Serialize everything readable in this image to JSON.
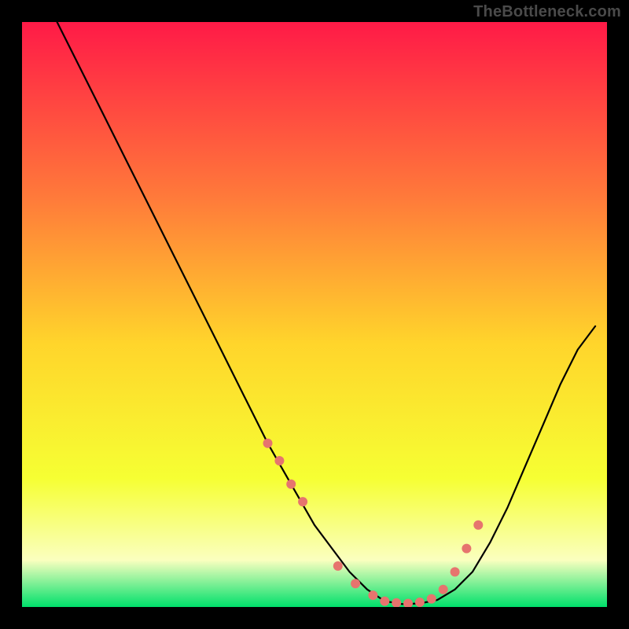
{
  "watermark": "TheBottleneck.com",
  "colors": {
    "gradient_top": "#ff1a47",
    "gradient_mid1": "#ff7a3a",
    "gradient_mid2": "#ffd52b",
    "gradient_mid3": "#f6ff33",
    "gradient_bottom_yellow": "#faffbf",
    "gradient_bottom_green": "#00e06b",
    "curve": "#000000",
    "marker": "#e6746e",
    "background": "#000000"
  },
  "chart_data": {
    "type": "line",
    "title": "",
    "xlabel": "",
    "ylabel": "",
    "xlim": [
      0,
      100
    ],
    "ylim": [
      0,
      100
    ],
    "curve": {
      "x": [
        6,
        10,
        14,
        18,
        22,
        26,
        30,
        34,
        38,
        42,
        46,
        50,
        53,
        56,
        59,
        62,
        65,
        68,
        71,
        74,
        77,
        80,
        83,
        86,
        89,
        92,
        95,
        98
      ],
      "y": [
        100,
        92,
        84,
        76,
        68,
        60,
        52,
        44,
        36,
        28,
        21,
        14,
        10,
        6,
        3,
        1,
        0.5,
        0.6,
        1.2,
        3,
        6,
        11,
        17,
        24,
        31,
        38,
        44,
        48
      ]
    },
    "markers": {
      "x": [
        42,
        44,
        46,
        48,
        54,
        57,
        60,
        62,
        64,
        66,
        68,
        70,
        72,
        74,
        76,
        78
      ],
      "y": [
        28,
        25,
        21,
        18,
        7,
        4,
        2,
        1,
        0.7,
        0.6,
        0.8,
        1.4,
        3,
        6,
        10,
        14
      ]
    }
  }
}
